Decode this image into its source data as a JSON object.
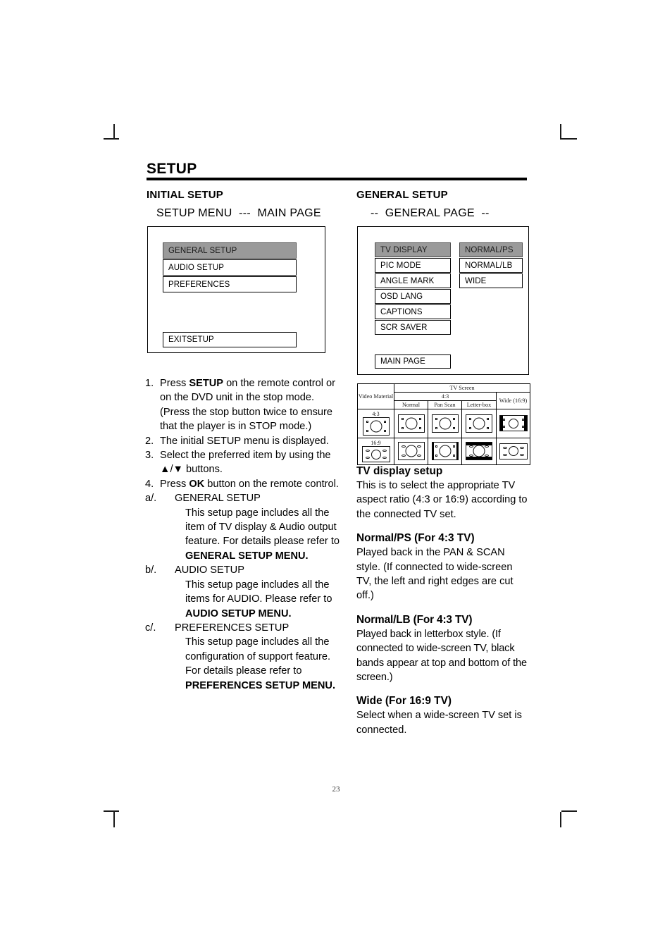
{
  "page": {
    "title": "SETUP",
    "number": "23"
  },
  "left_column": {
    "heading": "INITIAL SETUP",
    "subheading": "SETUP MENU  ---  MAIN PAGE",
    "osd_menu": {
      "items": [
        {
          "label": "GENERAL SETUP",
          "selected": true
        },
        {
          "label": "AUDIO SETUP",
          "selected": false
        },
        {
          "label": "PREFERENCES",
          "selected": false
        }
      ],
      "exit_label": "EXITSETUP"
    },
    "steps": [
      {
        "marker": "1.",
        "text_parts": [
          {
            "t": "Press ",
            "b": false
          },
          {
            "t": "SETUP",
            "b": true
          },
          {
            "t": " on the remote control or on the DVD unit in the stop mode. (Press the stop button twice to ensure that the player is in STOP mode.)",
            "b": false
          }
        ]
      },
      {
        "marker": "2.",
        "text_parts": [
          {
            "t": "The initial SETUP menu is displayed.",
            "b": false
          }
        ]
      },
      {
        "marker": "3.",
        "text_parts": [
          {
            "t": "Select the preferred item by using the ▲/▼ buttons.",
            "b": false
          }
        ]
      },
      {
        "marker": "4.",
        "text_parts": [
          {
            "t": "Press ",
            "b": false
          },
          {
            "t": "OK",
            "b": true
          },
          {
            "t": " button on the remote control.",
            "b": false
          }
        ]
      }
    ],
    "sub_steps": [
      {
        "marker": "a/.",
        "title": "GENERAL SETUP",
        "text_parts": [
          {
            "t": "This setup page includes all the item of TV display & Audio output feature. For details please refer to ",
            "b": false
          },
          {
            "t": "GENERAL SETUP MENU.",
            "b": true
          }
        ]
      },
      {
        "marker": "b/.",
        "title": "AUDIO SETUP",
        "text_parts": [
          {
            "t": "This setup page includes all the items for AUDIO. Please refer to ",
            "b": false
          },
          {
            "t": "AUDIO SETUP MENU.",
            "b": true
          }
        ]
      },
      {
        "marker": "c/.",
        "title": "PREFERENCES SETUP",
        "text_parts": [
          {
            "t": "This setup page includes all the configuration of support feature. For details please refer to ",
            "b": false
          },
          {
            "t": "PREFERENCES SETUP MENU.",
            "b": true
          }
        ]
      }
    ]
  },
  "right_column": {
    "heading": "GENERAL SETUP",
    "subheading": "--  GENERAL PAGE  --",
    "osd_menu": {
      "items": [
        {
          "label": "TV DISPLAY",
          "selected": true
        },
        {
          "label": "PIC MODE",
          "selected": false
        },
        {
          "label": "ANGLE MARK",
          "selected": false
        },
        {
          "label": "OSD LANG",
          "selected": false
        },
        {
          "label": "CAPTIONS",
          "selected": false
        },
        {
          "label": "SCR SAVER",
          "selected": false
        }
      ],
      "sub_items": [
        {
          "label": "NORMAL/PS",
          "selected": true
        },
        {
          "label": "NORMAL/LB",
          "selected": false
        },
        {
          "label": "WIDE",
          "selected": false
        }
      ],
      "back_label": "MAIN PAGE"
    },
    "sections": [
      {
        "heading": "TV display setup",
        "body": "This is to select the appropriate TV aspect ratio (4:3 or 16:9) according to the connected TV set.",
        "narrow": false
      },
      {
        "heading": "Normal/PS (For 4:3 TV)",
        "body": "Played back in the PAN & SCAN style. (If connected to wide-screen TV, the left and right edges are cut off.)",
        "narrow": false
      },
      {
        "heading": "Normal/LB (For 4:3 TV)",
        "body": "Played back in letterbox style. (If connected to wide-screen TV, black bands appear at top and bottom of the screen.)",
        "narrow": true
      },
      {
        "heading": "Wide (For 16:9 TV)",
        "body": "Select when a wide-screen TV set is connected.",
        "narrow": false
      }
    ]
  },
  "tv_table": {
    "col_header_material": "Video Material",
    "col_header_screen": "TV Screen",
    "group_43": "4:3",
    "group_wide": "Wide (16:9)",
    "sub_headers": [
      "Normal",
      "Pan Scan",
      "Letter-box"
    ],
    "row_labels": [
      "4:3",
      "16:9"
    ],
    "rows": [
      {
        "label": "4:3",
        "source": {
          "ratio": "4:3",
          "marks": "corners-square"
        },
        "cells": [
          {
            "ratio": "4:3",
            "marks": "corners-square",
            "bands": "none"
          },
          {
            "ratio": "4:3",
            "marks": "corners-square",
            "bands": "none"
          },
          {
            "ratio": "4:3",
            "marks": "corners-square",
            "bands": "none"
          },
          {
            "ratio": "16:9",
            "marks": "corners-square",
            "bands": "sides"
          }
        ]
      },
      {
        "label": "16:9",
        "source": {
          "ratio": "16:9",
          "marks": "corners-oval"
        },
        "cells": [
          {
            "ratio": "4:3",
            "marks": "corners-oval",
            "bands": "none"
          },
          {
            "ratio": "4:3",
            "marks": "corners-square",
            "bands": "sides-thin"
          },
          {
            "ratio": "4:3",
            "marks": "corners-oval",
            "bands": "topbottom"
          },
          {
            "ratio": "16:9",
            "marks": "corners-oval",
            "bands": "none"
          }
        ]
      }
    ]
  }
}
